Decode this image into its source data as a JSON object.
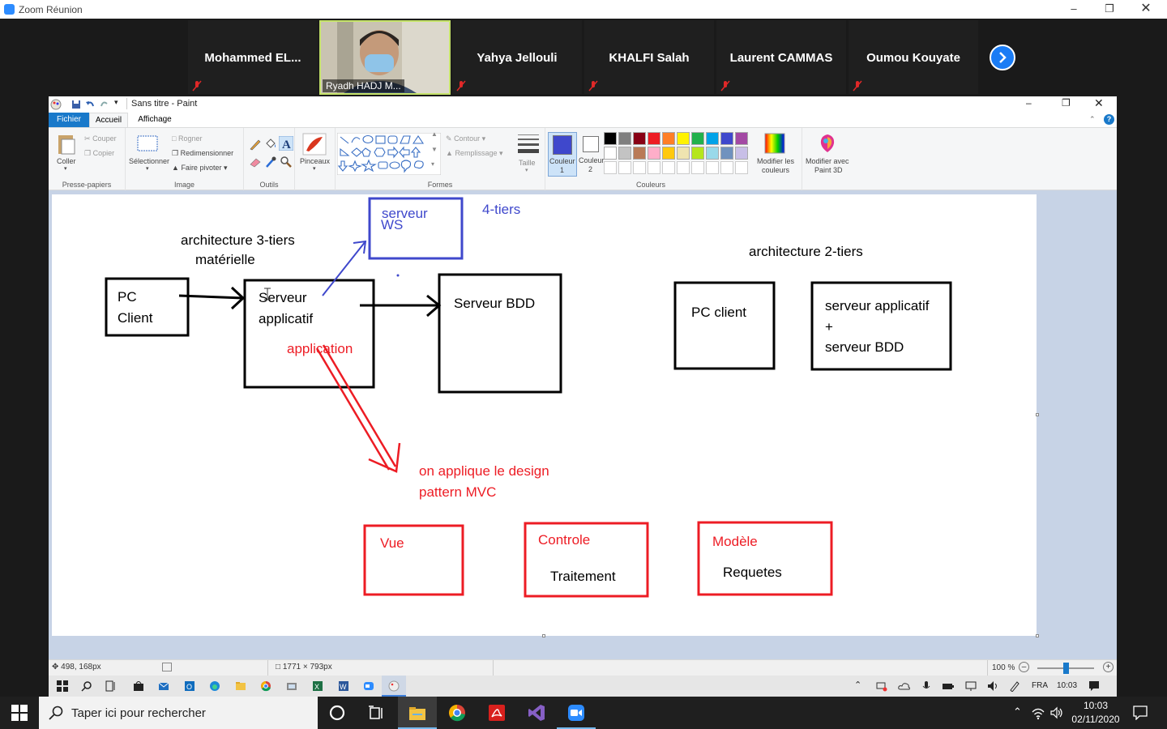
{
  "zoom": {
    "window_title": "Zoom Réunion",
    "participants": [
      {
        "name": "Mohammed  EL..."
      },
      {
        "name": "Yahya Jellouli"
      },
      {
        "name": "KHALFI Salah"
      },
      {
        "name": "Laurent CAMMAS"
      },
      {
        "name": "Oumou Kouyate"
      }
    ],
    "video_participant": "Ryadh HADJ M..."
  },
  "paint": {
    "title": "Sans titre - Paint",
    "tabs": {
      "file": "Fichier",
      "home": "Accueil",
      "view": "Affichage"
    },
    "clipboard": {
      "paste": "Coller",
      "cut": "Couper",
      "copy": "Copier",
      "label": "Presse-papiers"
    },
    "image": {
      "select": "Sélectionner",
      "crop": "Rogner",
      "resize": "Redimensionner",
      "rotate": "Faire pivoter",
      "label": "Image"
    },
    "tools": {
      "label": "Outils",
      "brushes": "Pinceaux"
    },
    "shapes": {
      "outline": "Contour",
      "fill": "Remplissage",
      "label": "Formes"
    },
    "size": {
      "label": "Taille"
    },
    "colors": {
      "color1_a": "Couleur",
      "color1_b": "1",
      "color2_a": "Couleur",
      "color2_b": "2",
      "edit_a": "Modifier les",
      "edit_b": "couleurs",
      "label": "Couleurs",
      "paint3d_a": "Modifier avec",
      "paint3d_b": "Paint 3D",
      "color1_value": "#3f48cc",
      "palette_row1": [
        "#000000",
        "#7f7f7f",
        "#880015",
        "#ed1c24",
        "#ff7f27",
        "#fff200",
        "#22b14c",
        "#00a2e8",
        "#3f48cc",
        "#a349a4"
      ],
      "palette_row2": [
        "#ffffff",
        "#c3c3c3",
        "#b97a57",
        "#ffaec9",
        "#ffc90e",
        "#efe4b0",
        "#b5e61d",
        "#99d9ea",
        "#7092be",
        "#c8bfe7"
      ]
    },
    "status": {
      "cursor": "498, 168px",
      "dimensions": "1771 × 793px",
      "zoom": "100 %",
      "zoom_level_fraction": 0.5
    },
    "apps_tray": {
      "lang": "FRA",
      "time": "10:03"
    }
  },
  "drawing": {
    "title_3tier_a": "architecture 3-tiers",
    "title_3tier_b": "matérielle",
    "pc_client_a": "PC",
    "pc_client_b": "Client",
    "app_server_a": "Serveur",
    "app_server_b": "applicatif",
    "application": "application",
    "ws_a": "serveur",
    "ws_b": "WS",
    "four_tiers": "4-tiers",
    "db_server": "Serveur BDD",
    "title_2tier": "architecture 2-tiers",
    "pc_client2": "PC client",
    "server2_a": "serveur applicatif",
    "server2_b": "+",
    "server2_c": "serveur BDD",
    "mvc_a": "on applique le design",
    "mvc_b": "pattern MVC",
    "vue": "Vue",
    "controle": "Controle",
    "traitement": "Traitement",
    "modele": "Modèle",
    "requetes": "Requetes",
    "colors": {
      "black": "#000000",
      "blue": "#3f48cc",
      "red": "#ed1c24"
    }
  },
  "taskbar": {
    "search_placeholder": "Taper ici pour rechercher",
    "time": "10:03",
    "date": "02/11/2020"
  }
}
